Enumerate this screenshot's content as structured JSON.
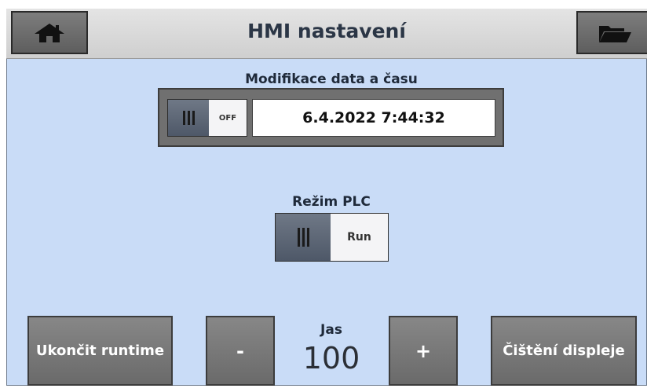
{
  "header": {
    "title": "HMI nastavení",
    "home_icon": "home-icon",
    "folder_icon": "folder-open-icon"
  },
  "datetime": {
    "label": "Modifikace data a času",
    "toggle_state": "OFF",
    "value": "6.4.2022 7:44:32"
  },
  "plc": {
    "label": "Režim PLC",
    "toggle_state": "Run"
  },
  "buttons": {
    "exit_runtime": "Ukončit runtime",
    "minus": "-",
    "plus": "+",
    "clean_display": "Čištění displeje"
  },
  "brightness": {
    "label": "Jas",
    "value": "100"
  },
  "colors": {
    "background": "#c9dcf7",
    "header": "#d8d8d8",
    "button": "#7a7a7a",
    "title_text": "#2b3646"
  }
}
